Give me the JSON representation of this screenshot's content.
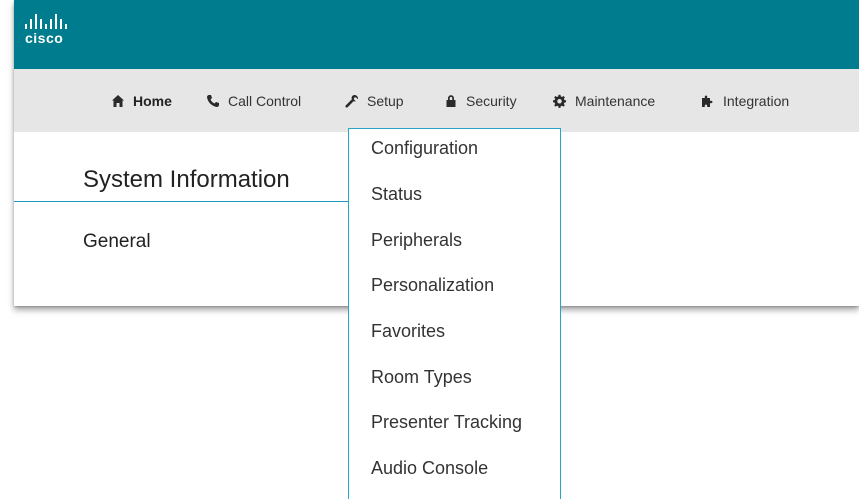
{
  "brand": {
    "logo_text": "cisco",
    "color": "#007c8f"
  },
  "nav": {
    "items": [
      {
        "label": "Home",
        "icon": "home-icon",
        "active": true
      },
      {
        "label": "Call Control",
        "icon": "phone-icon"
      },
      {
        "label": "Setup",
        "icon": "wrench-icon"
      },
      {
        "label": "Security",
        "icon": "lock-icon"
      },
      {
        "label": "Maintenance",
        "icon": "gear-icon"
      },
      {
        "label": "Integration",
        "icon": "puzzle-icon"
      }
    ]
  },
  "page": {
    "title": "System Information",
    "section": "General"
  },
  "setup_menu": {
    "items": [
      "Configuration",
      "Status",
      "Peripherals",
      "Personalization",
      "Favorites",
      "Room Types",
      "Presenter Tracking",
      "Audio Console"
    ]
  },
  "colors": {
    "topbar": "#007c8f",
    "navbar": "#e6e6e6",
    "accent": "#29a3cc"
  }
}
